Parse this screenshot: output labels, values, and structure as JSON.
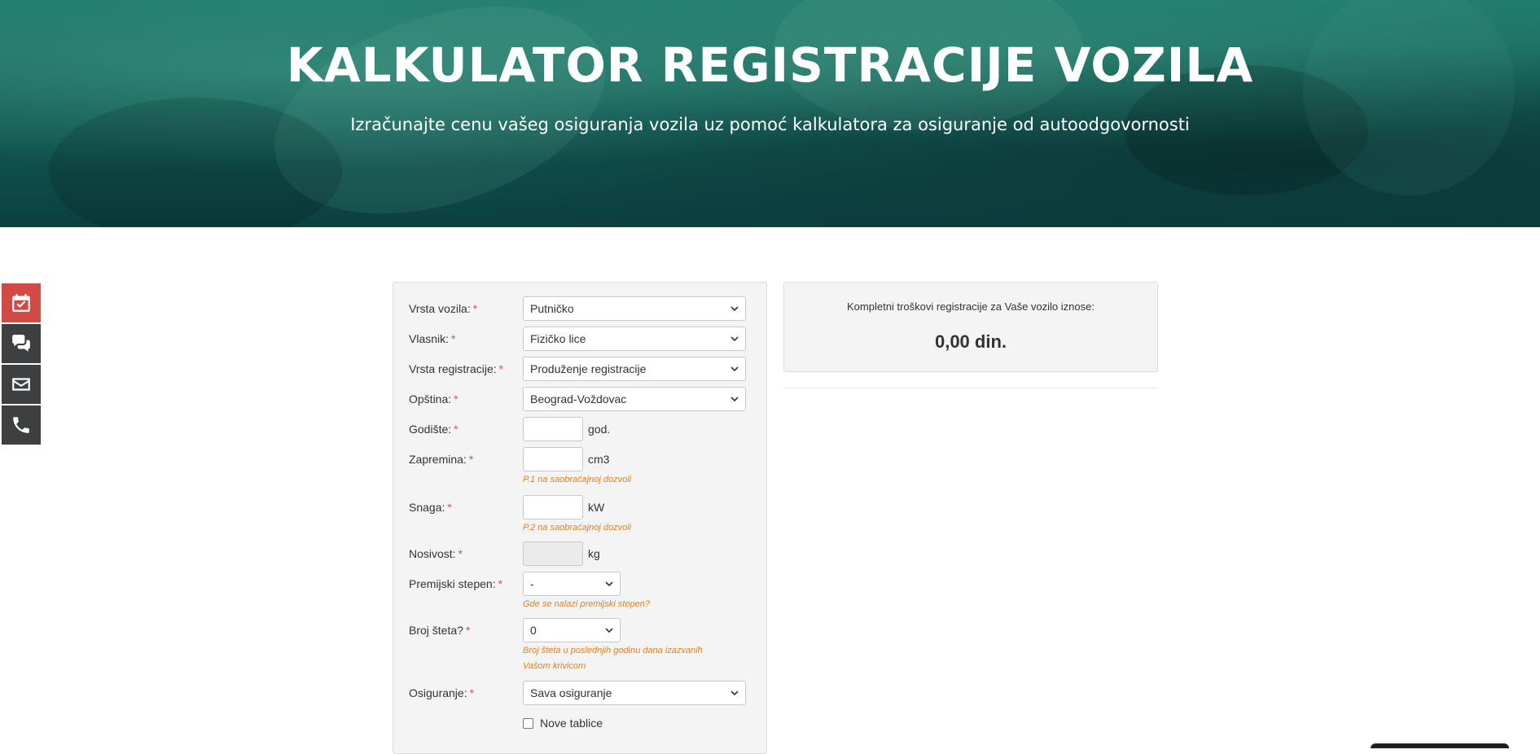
{
  "hero": {
    "title": "KALKULATOR REGISTRACIJE VOZILA",
    "subtitle": "Izračunajte cenu vašeg osiguranja vozila uz pomoć kalkulatora za osiguranje od autoodgovornosti"
  },
  "side_bar": {
    "icons": [
      "calendar-check-icon",
      "chat-icon",
      "envelope-icon",
      "phone-icon"
    ],
    "colors": {
      "calendar": "#d14a43",
      "default": "#3d3f41"
    }
  },
  "form": {
    "required_mark": "*",
    "vehicle_type": {
      "label": "Vrsta vozila:",
      "value": "Putničko"
    },
    "owner": {
      "label": "Vlasnik:",
      "value": "Fizičko lice"
    },
    "registration_type": {
      "label": "Vrsta registracije:",
      "value": "Produženje registracije"
    },
    "municipality": {
      "label": "Opština:",
      "value": "Beograd-Voždovac"
    },
    "year": {
      "label": "Godište:",
      "value": "",
      "unit": "god."
    },
    "volume": {
      "label": "Zapremina:",
      "value": "",
      "unit": "cm3",
      "hint": "P.1 na saobraćajnoj dozvoli"
    },
    "power": {
      "label": "Snaga:",
      "value": "",
      "unit": "kW",
      "hint": "P.2 na saobraćajnoj dozvoli"
    },
    "load_capacity": {
      "label": "Nosivost:",
      "value": "",
      "unit": "kg"
    },
    "premium_level": {
      "label": "Premijski stepen:",
      "value": "-",
      "hint": "Gde se nalazi premijski stepen?"
    },
    "damage_count": {
      "label": "Broj šteta?",
      "value": "0",
      "hint_line1": "Broj šteta u poslednjih godinu dana izazvanih",
      "hint_line2": "Vašom krivicom"
    },
    "insurance": {
      "label": "Osiguranje:",
      "value": "Sava osiguranje"
    },
    "new_plates": {
      "label": "Nove tablice",
      "checked": false
    }
  },
  "result": {
    "label": "Kompletni troškovi registracije za Vaše vozilo iznose:",
    "amount": "0,00 din."
  }
}
